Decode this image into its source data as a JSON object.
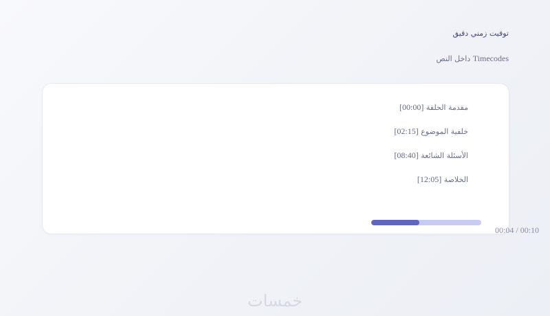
{
  "header": {
    "title": "توقيت زمني دقيق",
    "subtitle_latin": "Timecodes",
    "subtitle_arabic": "داخل النص"
  },
  "timecodes": [
    {
      "time": "[00:00]",
      "label": "مقدمة الحلقة"
    },
    {
      "time": "[02:15]",
      "label": "خلفية الموضوع"
    },
    {
      "time": "[08:40]",
      "label": "الأسئلة الشائعة"
    },
    {
      "time": "[12:05]",
      "label": "الخلاصة"
    }
  ],
  "player": {
    "progress": 0.44,
    "current_time": "00:04",
    "separator": "/",
    "total_time": "00:10"
  },
  "brand": {
    "logo_text": "خمسات"
  },
  "colors": {
    "accent": "#6066bd",
    "track": "#c8ccf1",
    "title": "#3d4494",
    "text": "#6b6f8a"
  }
}
